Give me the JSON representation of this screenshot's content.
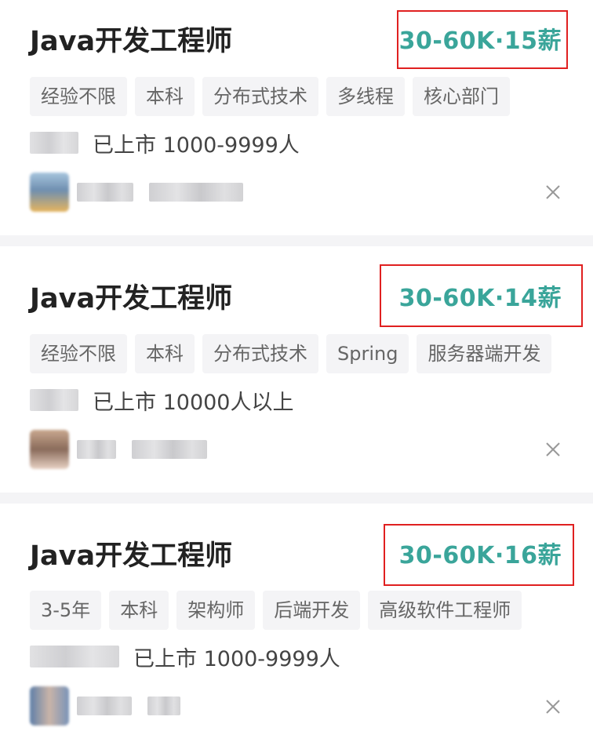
{
  "jobs": [
    {
      "title": "Java开发工程师",
      "salary": "30-60K·15薪",
      "tags": [
        "经验不限",
        "本科",
        "分布式技术",
        "多线程",
        "核心部门"
      ],
      "company_info": "已上市  1000-9999人"
    },
    {
      "title": "Java开发工程师",
      "salary": "30-60K·14薪",
      "tags": [
        "经验不限",
        "本科",
        "分布式技术",
        "Spring",
        "服务器端开发"
      ],
      "company_info": "已上市  10000人以上"
    },
    {
      "title": "Java开发工程师",
      "salary": "30-60K·16薪",
      "tags": [
        "3-5年",
        "本科",
        "架构师",
        "后端开发",
        "高级软件工程师"
      ],
      "company_info": "已上市  1000-9999人"
    }
  ],
  "colors": {
    "salary": "#3aa59a",
    "highlight_box": "#e02020",
    "tag_bg": "#f4f4f6",
    "title": "#222222"
  },
  "icons": {
    "dismiss": "close-icon"
  }
}
